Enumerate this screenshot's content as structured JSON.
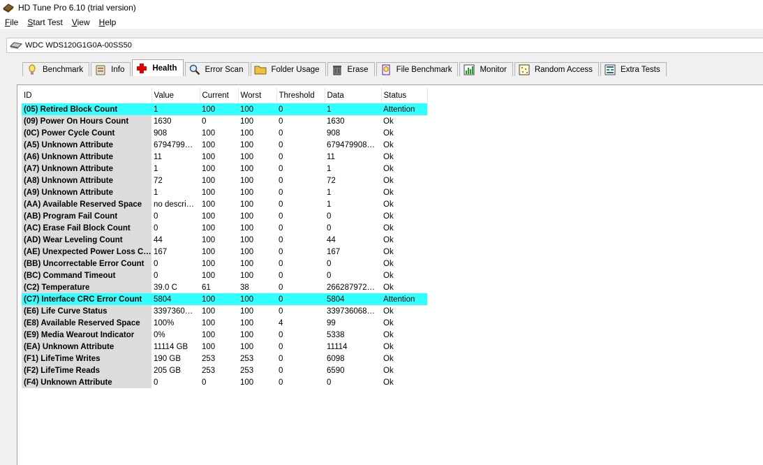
{
  "window": {
    "title": "HD Tune Pro 6.10 (trial version)"
  },
  "menu": [
    {
      "key": "F",
      "rest": "ile"
    },
    {
      "key": "S",
      "rest": "tart Test"
    },
    {
      "key": "V",
      "rest": "iew"
    },
    {
      "key": "H",
      "rest": "elp"
    }
  ],
  "drive": {
    "name": "WDC WDS120G1G0A-00SS50"
  },
  "tabs": [
    {
      "label": "Benchmark",
      "icon": "benchmark-icon"
    },
    {
      "label": "Info",
      "icon": "info-icon"
    },
    {
      "label": "Health",
      "icon": "health-icon",
      "active": true
    },
    {
      "label": "Error Scan",
      "icon": "error-scan-icon"
    },
    {
      "label": "Folder Usage",
      "icon": "folder-icon"
    },
    {
      "label": "Erase",
      "icon": "erase-icon"
    },
    {
      "label": "File Benchmark",
      "icon": "file-benchmark-icon"
    },
    {
      "label": "Monitor",
      "icon": "monitor-icon"
    },
    {
      "label": "Random Access",
      "icon": "random-access-icon"
    },
    {
      "label": "Extra Tests",
      "icon": "extra-tests-icon"
    }
  ],
  "colors": {
    "attention_row": "#33ffff",
    "id_column_bg": "#dcdcdc"
  },
  "table": {
    "columns": [
      "ID",
      "Value",
      "Current",
      "Worst",
      "Threshold",
      "Data",
      "Status"
    ],
    "rows": [
      [
        "(05) Retired Block Count",
        "1",
        "100",
        "100",
        "0",
        "1",
        "Attention"
      ],
      [
        "(09) Power On Hours Count",
        "1630",
        "0",
        "100",
        "0",
        "1630",
        "Ok"
      ],
      [
        "(0C) Power Cycle Count",
        "908",
        "100",
        "100",
        "0",
        "908",
        "Ok"
      ],
      [
        "(A5) Unknown Attribute",
        "6794799…",
        "100",
        "100",
        "0",
        "679479908…",
        "Ok"
      ],
      [
        "(A6) Unknown Attribute",
        "11",
        "100",
        "100",
        "0",
        "11",
        "Ok"
      ],
      [
        "(A7) Unknown Attribute",
        "1",
        "100",
        "100",
        "0",
        "1",
        "Ok"
      ],
      [
        "(A8) Unknown Attribute",
        "72",
        "100",
        "100",
        "0",
        "72",
        "Ok"
      ],
      [
        "(A9) Unknown Attribute",
        "1",
        "100",
        "100",
        "0",
        "1",
        "Ok"
      ],
      [
        "(AA) Available Reserved Space",
        "no descri…",
        "100",
        "100",
        "0",
        "1",
        "Ok"
      ],
      [
        "(AB) Program Fail Count",
        "0",
        "100",
        "100",
        "0",
        "0",
        "Ok"
      ],
      [
        "(AC) Erase Fail Block Count",
        "0",
        "100",
        "100",
        "0",
        "0",
        "Ok"
      ],
      [
        "(AD) Wear Leveling Count",
        "44",
        "100",
        "100",
        "0",
        "44",
        "Ok"
      ],
      [
        "(AE) Unexpected Power Loss C…",
        "167",
        "100",
        "100",
        "0",
        "167",
        "Ok"
      ],
      [
        "(BB) Uncorrectable Error Count",
        "0",
        "100",
        "100",
        "0",
        "0",
        "Ok"
      ],
      [
        "(BC) Command Timeout",
        "0",
        "100",
        "100",
        "0",
        "0",
        "Ok"
      ],
      [
        "(C2) Temperature",
        "39.0 C",
        "61",
        "38",
        "0",
        "266287972…",
        "Ok"
      ],
      [
        "(C7) Interface CRC Error Count",
        "5804",
        "100",
        "100",
        "0",
        "5804",
        "Attention"
      ],
      [
        "(E6) Life Curve Status",
        "3397360…",
        "100",
        "100",
        "0",
        "339736068…",
        "Ok"
      ],
      [
        "(E8) Available Reserved Space",
        "100%",
        "100",
        "100",
        "4",
        "99",
        "Ok"
      ],
      [
        "(E9) Media Wearout Indicator",
        "0%",
        "100",
        "100",
        "0",
        "5338",
        "Ok"
      ],
      [
        "(EA) Unknown Attribute",
        "11114 GB",
        "100",
        "100",
        "0",
        "11114",
        "Ok"
      ],
      [
        "(F1) LifeTime Writes",
        "190 GB",
        "253",
        "253",
        "0",
        "6098",
        "Ok"
      ],
      [
        "(F2) LifeTime Reads",
        "205 GB",
        "253",
        "253",
        "0",
        "6590",
        "Ok"
      ],
      [
        "(F4) Unknown Attribute",
        "0",
        "0",
        "100",
        "0",
        "0",
        "Ok"
      ]
    ]
  }
}
